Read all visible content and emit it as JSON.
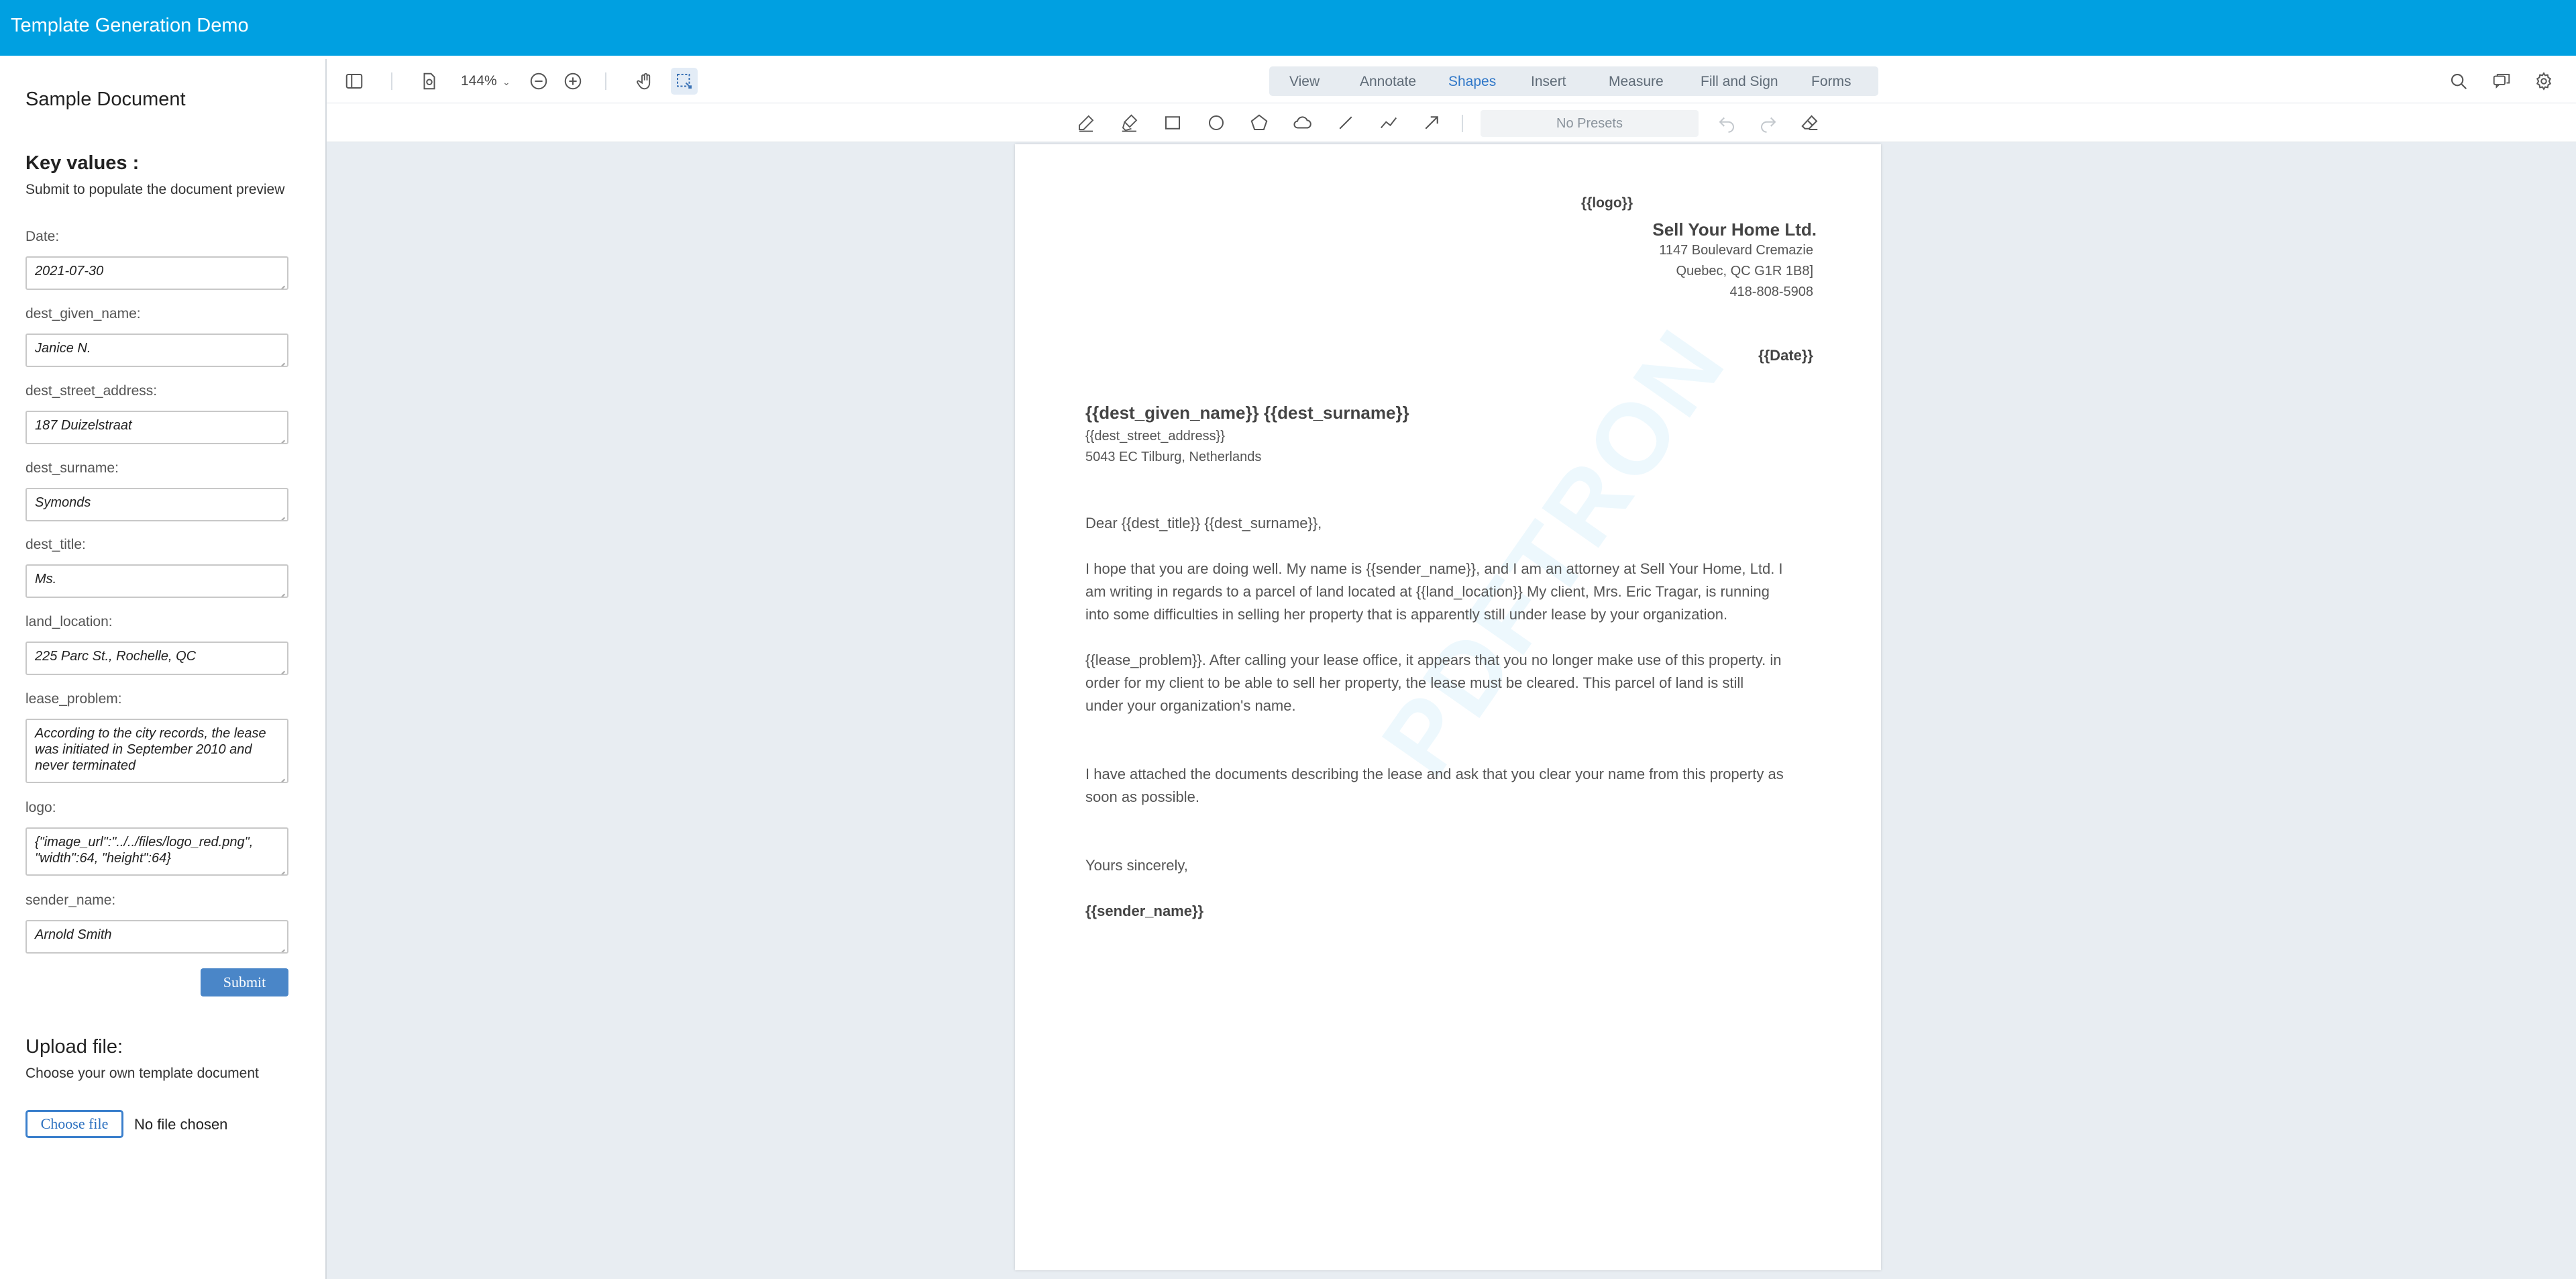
{
  "header": {
    "title": "Template Generation Demo"
  },
  "sidebar": {
    "doc_title": "Sample Document",
    "key_values_title": "Key values :",
    "key_values_sub": "Submit to populate the document preview",
    "fields": [
      {
        "label": "Date:",
        "value": "2021-07-30"
      },
      {
        "label": "dest_given_name:",
        "value": "Janice N."
      },
      {
        "label": "dest_street_address:",
        "value": "187 Duizelstraat"
      },
      {
        "label": "dest_surname:",
        "value": "Symonds"
      },
      {
        "label": "dest_title:",
        "value": "Ms."
      },
      {
        "label": "land_location:",
        "value": "225 Parc St., Rochelle, QC"
      },
      {
        "label": "lease_problem:",
        "value": "According to the city records, the lease was initiated in September 2010 and never terminated"
      },
      {
        "label": "logo:",
        "value": "{\"image_url\":\"../../files/logo_red.png\", \"width\":64, \"height\":64}"
      },
      {
        "label": "sender_name:",
        "value": "Arnold Smith"
      }
    ],
    "submit_label": "Submit",
    "upload_title": "Upload file:",
    "upload_sub": "Choose your own template document",
    "choose_label": "Choose file",
    "no_file": "No file chosen"
  },
  "viewer": {
    "zoom": "144%",
    "tabs": [
      "View",
      "Annotate",
      "Shapes",
      "Insert",
      "Measure",
      "Fill and Sign",
      "Forms"
    ],
    "active_tab": "Shapes",
    "presets": "No Presets"
  },
  "letter": {
    "logo": "{{logo}}",
    "company": "Sell Your Home Ltd.",
    "addr1": "1147 Boulevard Cremazie",
    "addr2": "Quebec, QC G1R 1B8]",
    "phone": "418-808-5908",
    "date": "{{Date}}",
    "recipient": "{{dest_given_name}} {{dest_surname}}",
    "street": "{{dest_street_address}}",
    "city": "5043 EC Tilburg, Netherlands",
    "salutation": "Dear {{dest_title}} {{dest_surname}},",
    "p1": [
      "I hope that you are doing well. My name is {{sender_name}}, and I am an attorney at Sell Your Home, Ltd. I",
      "am writing in regards to a parcel of land located at {{land_location}} My client, Mrs. Eric Tragar, is running",
      "into some difficulties in selling her property that is apparently still under lease by your organization."
    ],
    "p2": [
      "{{lease_problem}}. After calling your lease office, it appears that you no longer make use of this property. in",
      "order for my client to be able to sell her property, the lease must be cleared. This parcel of land is still",
      "under your organization's name."
    ],
    "p3": [
      "I have attached the documents describing the lease and ask that you clear your name from this property as",
      "soon as possible."
    ],
    "closing": "Yours sincerely,",
    "signature": "{{sender_name}}",
    "watermark": "PDFTRON"
  }
}
